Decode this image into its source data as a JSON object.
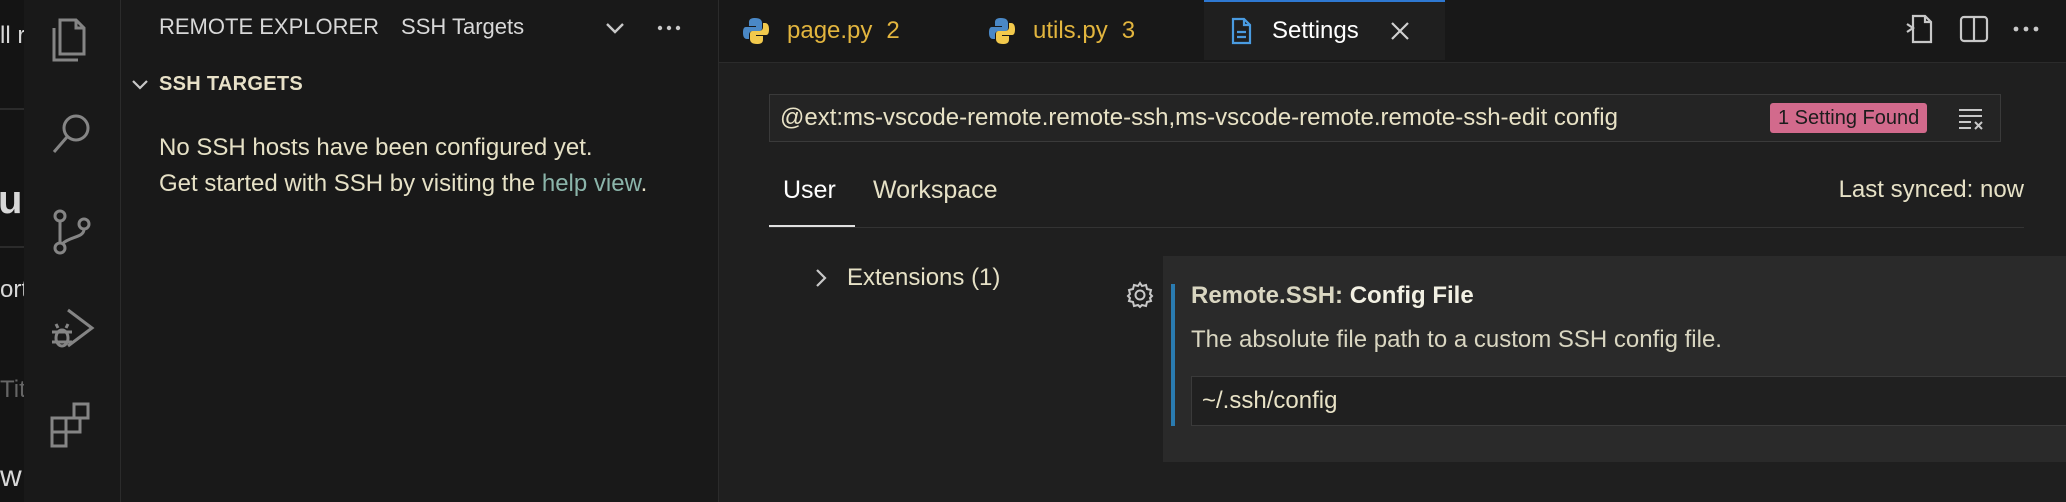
{
  "left_window_fragments": [
    "ll r",
    "u",
    "ort",
    "Tit",
    "w"
  ],
  "sidebar": {
    "title": "REMOTE EXPLORER",
    "dropdown_label": "SSH Targets",
    "section_title": "SSH TARGETS",
    "message_line1": "No SSH hosts have been configured yet.",
    "message_line2": "Get started with SSH by visiting the",
    "help_link": "help view",
    "period": "."
  },
  "activity_bar": {
    "icons": [
      "explorer-icon",
      "search-icon",
      "source-control-icon",
      "run-debug-icon",
      "extensions-icon"
    ]
  },
  "tabs": [
    {
      "name": "page.py",
      "count": "2",
      "icon": "python-icon",
      "color": "#e2b53e"
    },
    {
      "name": "utils.py",
      "count": "3",
      "icon": "python-icon",
      "color": "#e2b53e"
    },
    {
      "name": "Settings",
      "icon": "file-icon",
      "active": true
    }
  ],
  "settings": {
    "search_value": "@ext:ms-vscode-remote.remote-ssh,ms-vscode-remote.remote-ssh-edit config",
    "result_count": "1 Setting Found",
    "scope_tabs": [
      "User",
      "Workspace"
    ],
    "sync_status": "Last synced: now",
    "toc_item": "Extensions (1)",
    "setting": {
      "category": "Remote.SSH: ",
      "name": "Config File",
      "description": "The absolute file path to a custom SSH config file.",
      "value": "~/.ssh/config"
    }
  },
  "colors": {
    "accent_blue": "#2e78d2",
    "badge": "#d26a8c",
    "modified_tab": "#e2b53e",
    "link": "#8bb5aa"
  }
}
